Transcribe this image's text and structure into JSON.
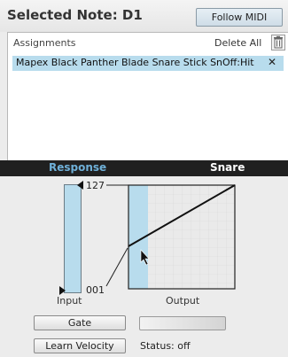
{
  "header": {
    "selected_note": "Selected Note: D1",
    "follow_midi_label": "Follow MIDI"
  },
  "assignments": {
    "title": "Assignments",
    "delete_all_label": "Delete All",
    "items": [
      {
        "label": "Mapex Black Panther Blade Snare Stick SnOff:Hit"
      }
    ]
  },
  "tabs": {
    "response": "Response",
    "snare": "Snare"
  },
  "graph": {
    "max_label": "127",
    "min_label": "001",
    "input_label": "Input",
    "output_label": "Output"
  },
  "controls": {
    "gate_label": "Gate",
    "learn_velocity_label": "Learn Velocity",
    "status": "Status: off"
  },
  "colors": {
    "accent": "#b8dced",
    "tab_active": "#6fb0d8",
    "tabbar_bg": "#202020"
  }
}
